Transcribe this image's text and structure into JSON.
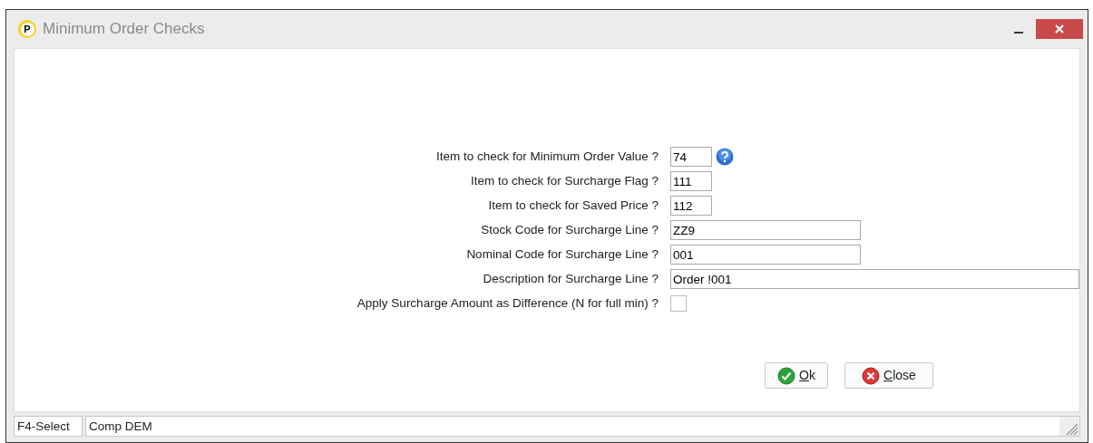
{
  "window": {
    "title": "Minimum Order Checks",
    "logo": "P"
  },
  "fields": [
    {
      "kind": "text",
      "label": "Item to check for Minimum Order Value ?",
      "value": "74",
      "help": true
    },
    {
      "kind": "text",
      "label": "Item to check for Surcharge Flag ?",
      "value": "111",
      "help": false
    },
    {
      "kind": "text",
      "label": "Item to check for Saved Price ?",
      "value": "112",
      "help": false
    },
    {
      "kind": "text",
      "label": "Stock Code for Surcharge Line ?",
      "value": "ZZ9",
      "help": false
    },
    {
      "kind": "text",
      "label": "Nominal Code for Surcharge Line ?",
      "value": "001",
      "help": false
    },
    {
      "kind": "text",
      "label": "Description for Surcharge Line ?",
      "value": "Order !001",
      "help": false
    },
    {
      "kind": "checkbox",
      "label": "Apply Surcharge Amount as Difference (N for full min) ?",
      "checked": false,
      "help": false
    }
  ],
  "buttons": [
    {
      "kind": "ok",
      "label": "Ok"
    },
    {
      "kind": "close",
      "label": "Close"
    }
  ],
  "status_bar": {
    "key_hint": "F4-Select",
    "company": "Comp DEM"
  }
}
